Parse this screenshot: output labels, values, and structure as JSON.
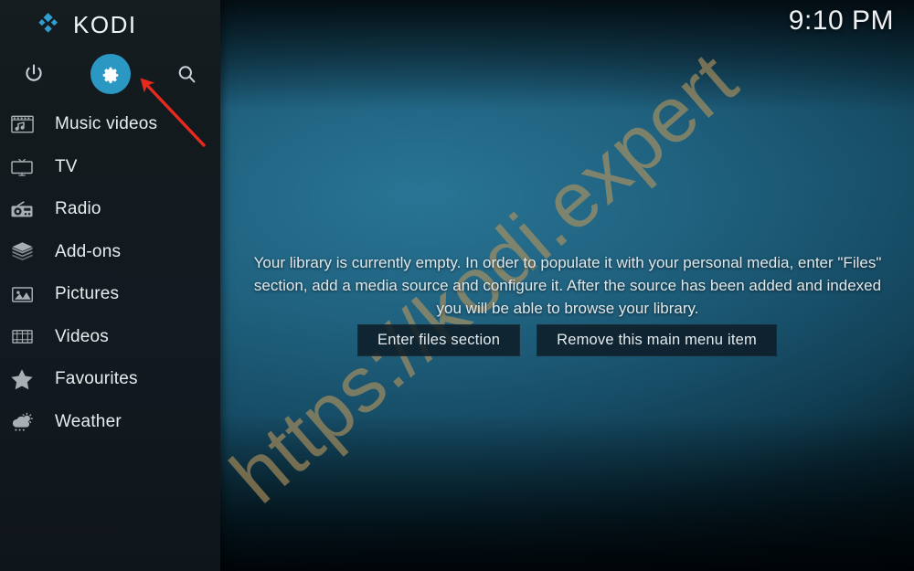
{
  "app": {
    "logo_text": "KODI",
    "logo_icon": "kodi-logo-icon"
  },
  "clock": {
    "time": "9:10 PM"
  },
  "toolbar": {
    "items": [
      {
        "name": "power",
        "icon": "power-icon",
        "label": "Power",
        "active": false
      },
      {
        "name": "settings",
        "icon": "gear-icon",
        "label": "Settings",
        "active": true
      },
      {
        "name": "search",
        "icon": "search-icon",
        "label": "Search",
        "active": false
      }
    ]
  },
  "sidebar": {
    "items": [
      {
        "label": "Music videos",
        "icon": "music-videos-icon"
      },
      {
        "label": "TV",
        "icon": "tv-icon"
      },
      {
        "label": "Radio",
        "icon": "radio-icon"
      },
      {
        "label": "Add-ons",
        "icon": "addons-box-icon"
      },
      {
        "label": "Pictures",
        "icon": "pictures-icon"
      },
      {
        "label": "Videos",
        "icon": "videos-film-icon"
      },
      {
        "label": "Favourites",
        "icon": "star-icon"
      },
      {
        "label": "Weather",
        "icon": "weather-cloud-icon"
      }
    ]
  },
  "main": {
    "empty_message": "Your library is currently empty. In order to populate it with your personal media, enter \"Files\" section, add a media source and configure it. After the source has been added and indexed you will be able to browse your library.",
    "buttons": [
      {
        "label": "Enter files section",
        "name": "enter-files-section-button"
      },
      {
        "label": "Remove this main menu item",
        "name": "remove-menu-item-button"
      }
    ]
  },
  "watermark": {
    "text": "https://kodi.expert",
    "color": "#b4945e"
  },
  "annotation": {
    "arrow_color": "#e8291e",
    "points_to": "settings"
  },
  "colors": {
    "accent": "#2b98c4",
    "sidebar_bg": "#131a1e",
    "background_teal": "#125267",
    "button_bg": "#0e1e28",
    "text_primary": "#e9edef"
  }
}
